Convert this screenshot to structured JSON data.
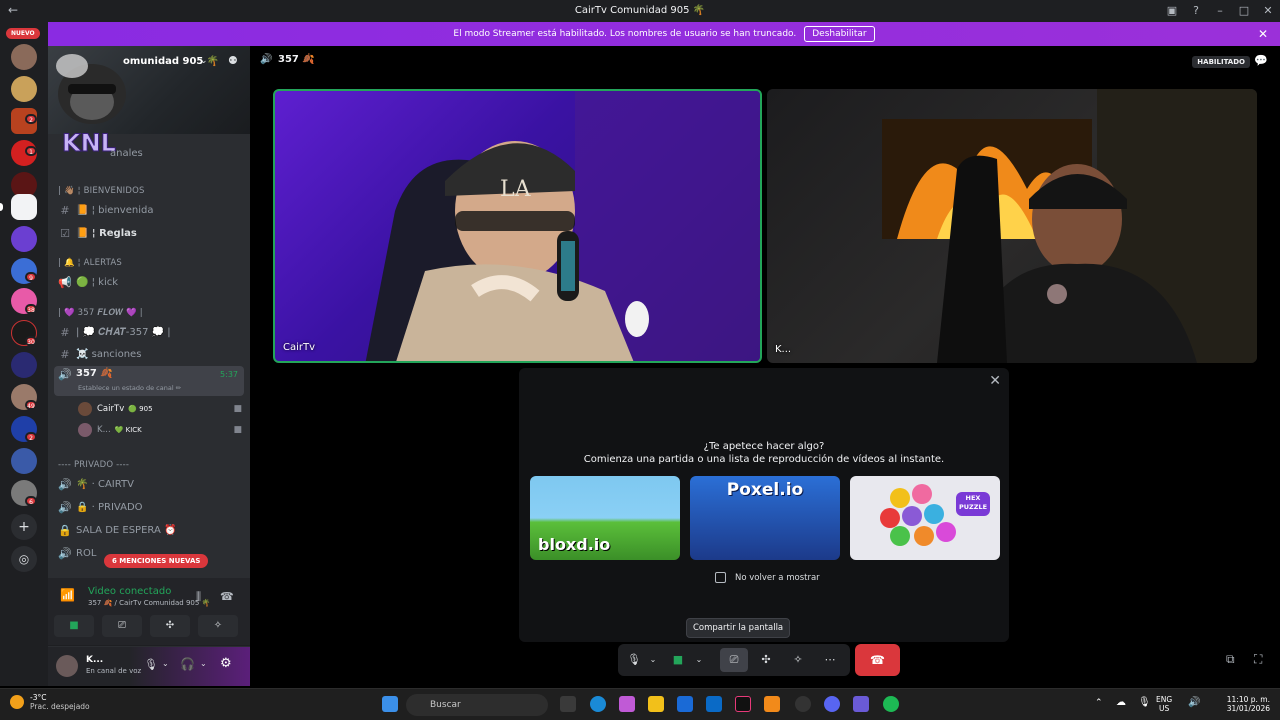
{
  "window": {
    "title": "CairTv Comunidad 905 🌴"
  },
  "banner": {
    "text": "El modo Streamer está habilitado. Los nombres de usuario se han truncado.",
    "button": "Deshabilitar"
  },
  "guilds": {
    "nuevo_label": "NUEVO",
    "badges": [
      "2",
      "1",
      "9",
      "38",
      "30",
      "49",
      "2",
      "6"
    ]
  },
  "server": {
    "name": "omunidad 905 🌴",
    "channels_label": "anales"
  },
  "channels": {
    "cat_bienvenidos": "| 👋🏽 ¦ BIENVENIDOS",
    "bienvenida": "📙 ¦ bienvenida",
    "reglas": "📙 ¦ Reglas",
    "cat_alertas": "| 🔔 ¦ ALERTAS",
    "kick": "🟢 ¦ kick",
    "cat_flow": "| 💜 357 𝑭𝑳𝑶𝑾 💜 |",
    "chat": "| 💭 𝑪𝑯𝑨𝑻-357 💭 |",
    "sanciones": "☠️ sanciones",
    "voice_active": "357 🍂",
    "voice_time": "5:37",
    "voice_status": "Establece un estado de canal ✏",
    "user1": "CairTv",
    "user1_tag": "🟢 905",
    "user2": "K...",
    "user2_tag": "💚 KICK",
    "cat_privado": "---- PRIVADO ----",
    "cairtv_ch": "🌴 · CAIRTV",
    "privado_ch": "🔒 · PRIVADO",
    "sala": "SALA DE ESPERA ⏰",
    "rol": "ROL",
    "mentions": "6 MENCIONES NUEVAS"
  },
  "voice_panel": {
    "title": "Video conectado",
    "subtitle": "357 🍂 / CairTv Comunidad 905 🌴"
  },
  "user_panel": {
    "name": "K...",
    "status": "En canal de voz"
  },
  "call": {
    "channel": "357 🍂",
    "badge": "HABILITADO",
    "tile1_name": "CairTv",
    "tile2_name": "K..."
  },
  "activity": {
    "question": "¿Te apetece hacer algo?",
    "subtitle": "Comienza una partida o una lista de reproducción de vídeos al instante.",
    "games": [
      "bloxd.io",
      "Poxel.io",
      "HEX PUZZLE"
    ],
    "checkbox_label": "No volver a mostrar"
  },
  "controls": {
    "tooltip": "Compartir la pantalla"
  },
  "taskbar": {
    "temp": "-3°C",
    "weather": "Prac. despejado",
    "search_placeholder": "Buscar",
    "lang1": "ENG",
    "lang2": "US",
    "time": "11:10 p. m.",
    "date": "31/01/2026"
  },
  "colors": {
    "accent": "#8a2be2",
    "green": "#23a55a",
    "red": "#da373c"
  }
}
